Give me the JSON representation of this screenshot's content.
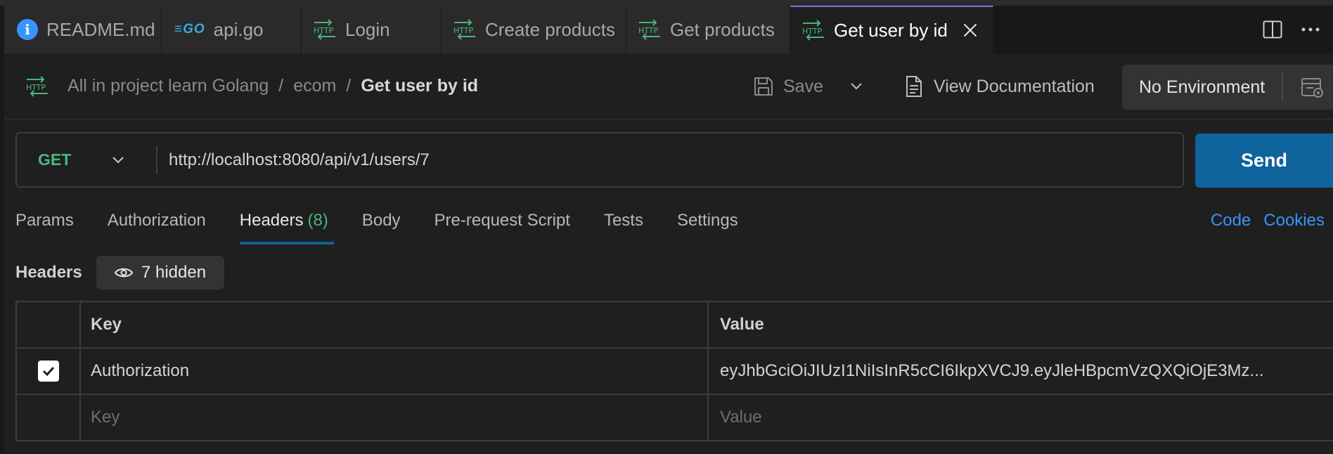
{
  "tabs": [
    {
      "label": "README.md",
      "icon": "info-icon"
    },
    {
      "label": "api.go",
      "icon": "go-file-icon"
    },
    {
      "label": "Login",
      "icon": "http-icon"
    },
    {
      "label": "Create products",
      "icon": "http-icon"
    },
    {
      "label": "Get products",
      "icon": "http-icon"
    },
    {
      "label": "Get user by id",
      "icon": "http-icon",
      "active": true
    }
  ],
  "go_icon_text": "≡GO",
  "breadcrumb": [
    "All in project learn Golang",
    "ecom",
    "Get user by id"
  ],
  "breadcrumb_sep": "/",
  "toolbar": {
    "save_label": "Save",
    "view_doc_label": "View Documentation",
    "environment_label": "No Environment"
  },
  "request": {
    "method": "GET",
    "url": "http://localhost:8080/api/v1/users/7",
    "send_label": "Send"
  },
  "subtabs": [
    {
      "label": "Params"
    },
    {
      "label": "Authorization"
    },
    {
      "label": "Headers",
      "count": "(8)",
      "active": true
    },
    {
      "label": "Body"
    },
    {
      "label": "Pre-request Script"
    },
    {
      "label": "Tests"
    },
    {
      "label": "Settings"
    }
  ],
  "links": {
    "code": "Code",
    "cookies": "Cookies"
  },
  "headers_section": {
    "title": "Headers",
    "hidden_label": "7 hidden"
  },
  "table": {
    "columns": [
      "Key",
      "Value"
    ],
    "rows": [
      {
        "checked": true,
        "key": "Authorization",
        "value": "eyJhbGciOiJIUzI1NiIsInR5cCI6IkpXVCJ9.eyJleHBpcmVzQXQiOjE3Mz..."
      }
    ],
    "empty_row": {
      "key_placeholder": "Key",
      "value_placeholder": "Value"
    }
  },
  "colors": {
    "accent": "#0e639c",
    "method_get": "#49b67d",
    "link": "#3794ff",
    "active_tab_border": "#8a73d8"
  }
}
